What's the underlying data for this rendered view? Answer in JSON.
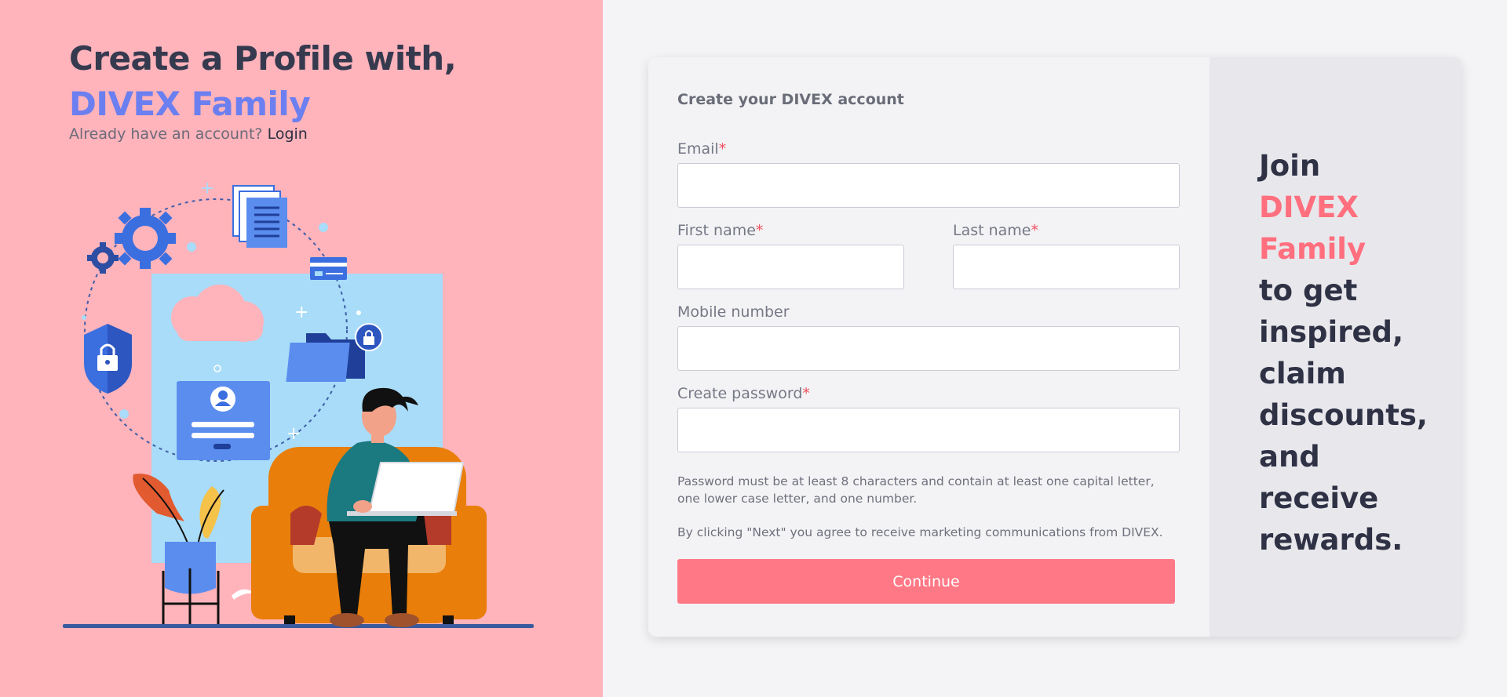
{
  "hero": {
    "title": "Create a Profile with,",
    "brand": "DIVEX Family",
    "login_prompt": "Already have an account?",
    "login_link": "Login"
  },
  "form": {
    "title": "Create your DIVEX account",
    "email_label": "Email",
    "first_name_label": "First name",
    "last_name_label": "Last name",
    "mobile_label": "Mobile number",
    "password_label": "Create password",
    "required_mark": "*",
    "password_hint": "Password must be at least 8 characters and contain at least one capital letter, one lower case letter, and one number.",
    "consent": "By clicking \"Next\" you agree to receive marketing communications from DIVEX.",
    "continue_label": "Continue",
    "email_value": "",
    "first_name_value": "",
    "last_name_value": "",
    "mobile_value": "",
    "password_value": ""
  },
  "side": {
    "join": "Join",
    "brand_line1": "DIVEX",
    "brand_line2": "Family",
    "lines": [
      "to get",
      "inspired,",
      "claim",
      "discounts,",
      "and",
      "receive",
      "rewards."
    ]
  },
  "colors": {
    "left_bg": "#ffb3bb",
    "brand_blue": "#6b7ff0",
    "accent_pink": "#ff7886",
    "dark_text": "#363a4f"
  },
  "icons": [
    "gear-icon",
    "document-icon",
    "card-icon",
    "shield-lock-icon",
    "cloud-icon",
    "folder-lock-icon",
    "user-login-icon",
    "plant-icon"
  ]
}
